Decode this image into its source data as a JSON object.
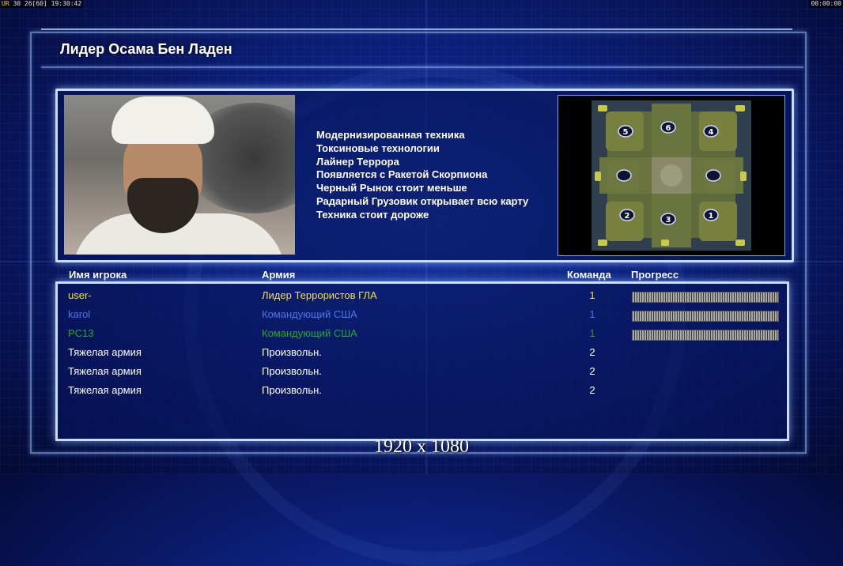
{
  "hud": {
    "left_tag": "UR",
    "left_text": "30 26[60] 19:30:42",
    "right_text": "00:00:00"
  },
  "title": "Лидер Осама Бен Ладен",
  "traits": [
    "Модернизированная техника",
    "Токсиновые технологии",
    "Лайнер Террора",
    "Появляется с Ракетой Скорпиона",
    "Черный Рынок стоит меньше",
    "Радарный Грузовик открывает всю карту",
    "Техника стоит дороже"
  ],
  "map": {
    "slot_labels": [
      "5",
      "6",
      "4",
      "2",
      "3",
      "1"
    ]
  },
  "table": {
    "headers": {
      "name": "Имя игрока",
      "army": "Армия",
      "team": "Команда",
      "progress": "Прогресс"
    },
    "rows": [
      {
        "name": "user-",
        "army": "Лидер Террористов ГЛА",
        "team": "1",
        "color": "#f0e23a",
        "progress": 1.0
      },
      {
        "name": "karol",
        "army": "Командующий США",
        "team": "1",
        "color": "#4a78e8",
        "progress": 1.0
      },
      {
        "name": "PC13",
        "army": "Командующий США",
        "team": "1",
        "color": "#28a828",
        "progress": 1.0
      },
      {
        "name": "Тяжелая армия",
        "army": "Произвольн.",
        "team": "2",
        "color": "#ffffff",
        "progress": null
      },
      {
        "name": "Тяжелая армия",
        "army": "Произвольн.",
        "team": "2",
        "color": "#ffffff",
        "progress": null
      },
      {
        "name": "Тяжелая армия",
        "army": "Произвольн.",
        "team": "2",
        "color": "#ffffff",
        "progress": null
      }
    ]
  },
  "resolution_caption": "1920 x 1080"
}
